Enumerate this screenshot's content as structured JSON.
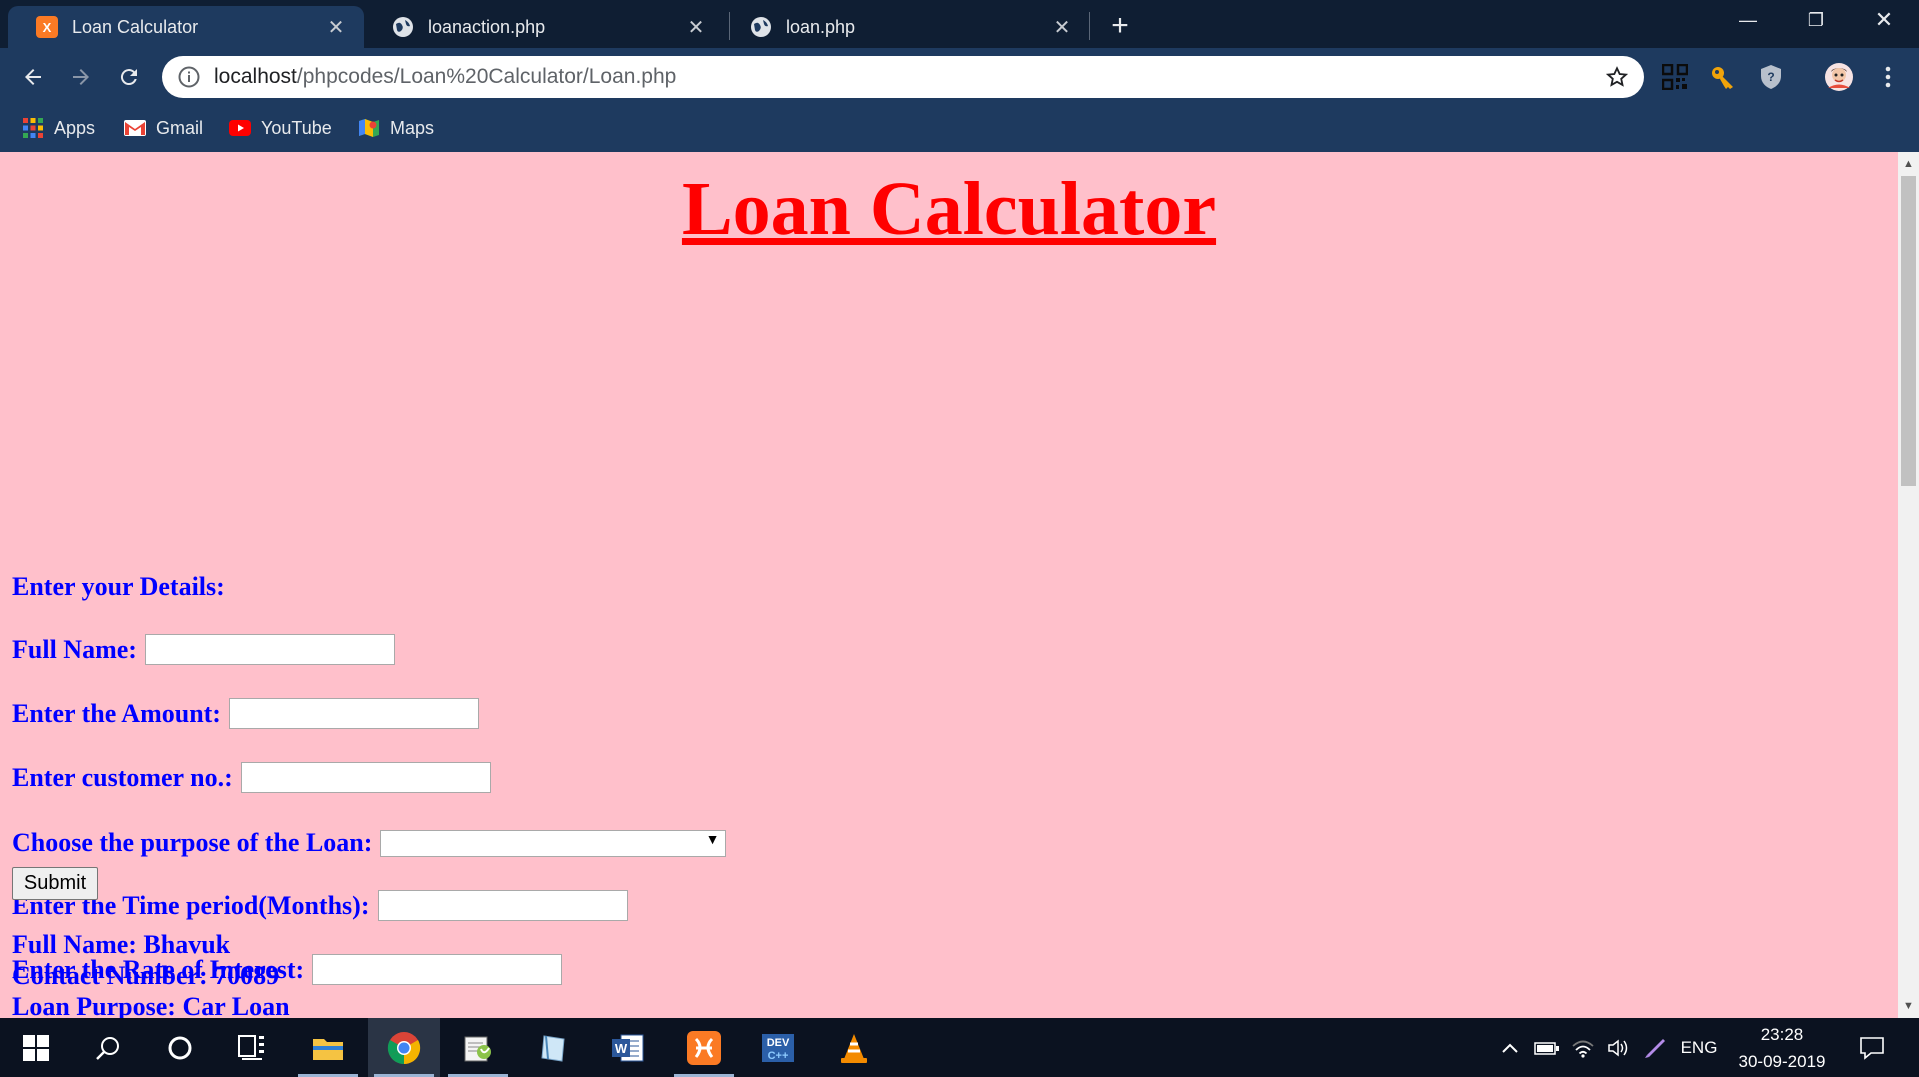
{
  "browser": {
    "tabs": [
      {
        "title": "Loan Calculator",
        "active": true,
        "icon": "xampp-icon"
      },
      {
        "title": "loanaction.php",
        "active": false,
        "icon": "globe-icon"
      },
      {
        "title": "loan.php",
        "active": false,
        "icon": "globe-icon"
      }
    ],
    "url_host": "localhost",
    "url_path": "/phpcodes/Loan%20Calculator/Loan.php",
    "bookmarks": [
      {
        "label": "Apps",
        "icon": "apps-grid-icon"
      },
      {
        "label": "Gmail",
        "icon": "gmail-icon"
      },
      {
        "label": "YouTube",
        "icon": "youtube-icon"
      },
      {
        "label": "Maps",
        "icon": "maps-icon"
      }
    ],
    "colors": {
      "frame": "#1e3a5f",
      "tabstrip": "#0f1e33"
    }
  },
  "page": {
    "heading": "Loan Calculator",
    "section_title": "Enter your Details:",
    "fields": {
      "full_name": {
        "label": "Full Name:",
        "value": ""
      },
      "amount": {
        "label": "Enter the Amount:",
        "value": ""
      },
      "customer_no": {
        "label": "Enter customer no.:",
        "value": ""
      },
      "purpose": {
        "label": "Choose the purpose of the Loan:",
        "value": ""
      },
      "time_period": {
        "label": "Enter the Time period(Months):",
        "value": ""
      },
      "rate": {
        "label": "Enter the Rate of Interest:",
        "value": ""
      }
    },
    "submit_label": "Submit",
    "results": [
      "Full Name: Bhavuk",
      "Contact Number: 70089",
      "Loan Purpose: Car Loan"
    ],
    "colors": {
      "background": "#ffc0cb",
      "heading": "#ff0000",
      "text": "#0000ff"
    }
  },
  "taskbar": {
    "language": "ENG",
    "time": "23:28",
    "date": "30-09-2019"
  }
}
